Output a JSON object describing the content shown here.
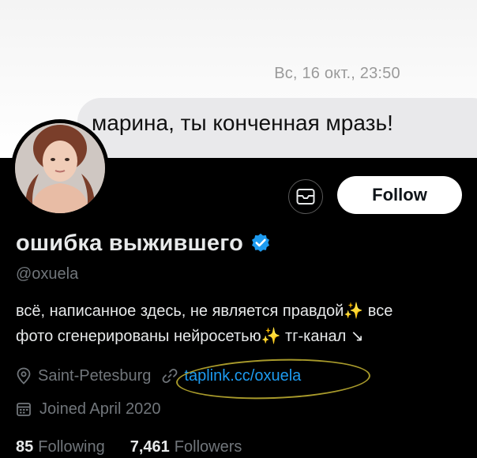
{
  "chat": {
    "timestamp": "Вс, 16 окт., 23:50",
    "message": "марина, ты конченная мразь!"
  },
  "profile": {
    "follow_label": "Follow",
    "name": "ошибка выжившего",
    "handle": "@oxuela",
    "bio_line1": "всё, написанное здесь, не является правдой",
    "bio_line1_tail": " все",
    "bio_line2": "фото сгенерированы нейросетью",
    "bio_line2_tail": " тг-канал ↘",
    "sparkle": "✨",
    "location": "Saint-Petesburg",
    "link": "taplink.cc/oxuela",
    "joined": "Joined April 2020",
    "following_count": "85",
    "following_label": "Following",
    "followers_count": "7,461",
    "followers_label": "Followers"
  },
  "icons": {
    "mail": "mail-icon",
    "verified": "verified-badge-icon",
    "location": "location-pin-icon",
    "link": "link-icon",
    "calendar": "calendar-icon"
  },
  "colors": {
    "accent_link": "#1d9bf0",
    "verified": "#1d9bf0",
    "annotation_circle": "#a89a2b"
  }
}
